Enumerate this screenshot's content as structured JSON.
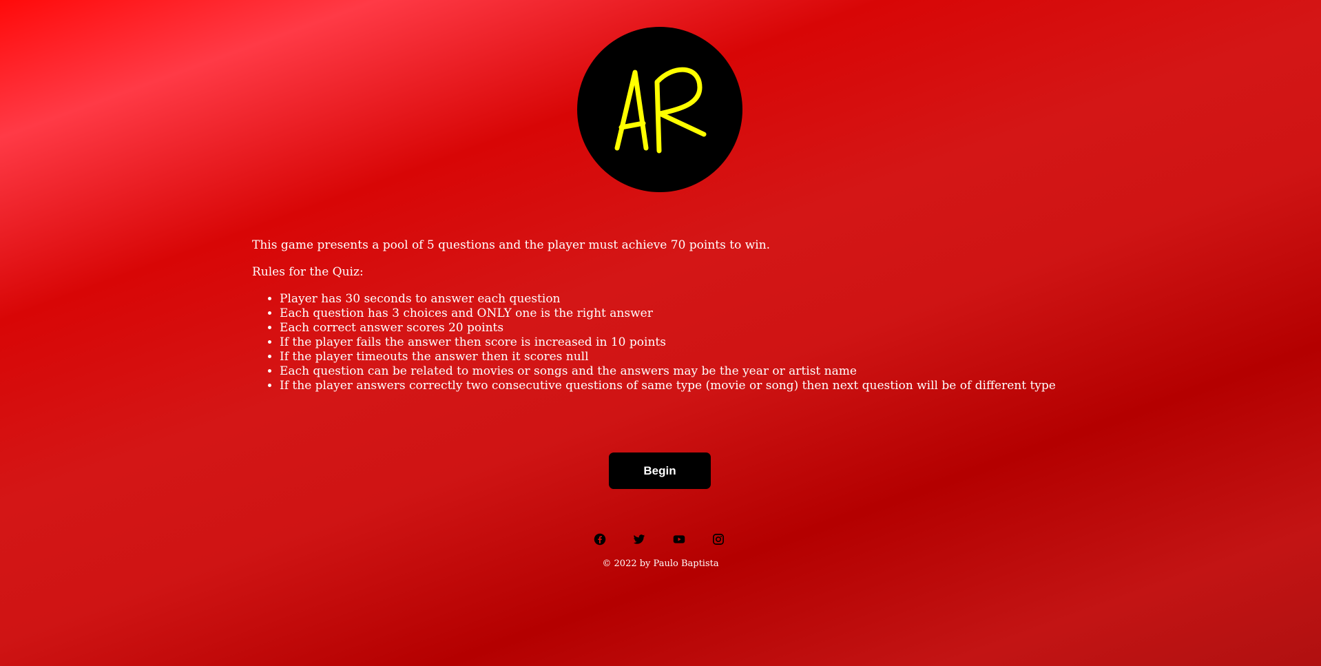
{
  "logo": {
    "text": "AR",
    "circle_color": "#000000",
    "text_color": "#ffff00"
  },
  "intro": "This game presents a pool of 5 questions and the player must achieve 70 points to win.",
  "rules_heading": "Rules for the Quiz:",
  "rules": [
    "Player has 30 seconds to answer each question",
    "Each question has 3 choices and ONLY one is the right answer",
    "Each correct answer scores 20 points",
    "If the player fails the answer then score is increased in 10 points",
    "If the player timeouts the answer then it scores null",
    "Each question can be related to movies or songs and the answers may be the year or artist name",
    "If the player answers correctly two consecutive questions of same type (movie or song) then next question will be of different type"
  ],
  "begin_button": "Begin",
  "social": [
    {
      "icon": "facebook-icon"
    },
    {
      "icon": "twitter-icon"
    },
    {
      "icon": "youtube-icon"
    },
    {
      "icon": "instagram-icon"
    }
  ],
  "copyright": "© 2022 by Paulo Baptista",
  "colors": {
    "background": "#d40a0a",
    "button": "#000000",
    "text": "#ffffff"
  }
}
